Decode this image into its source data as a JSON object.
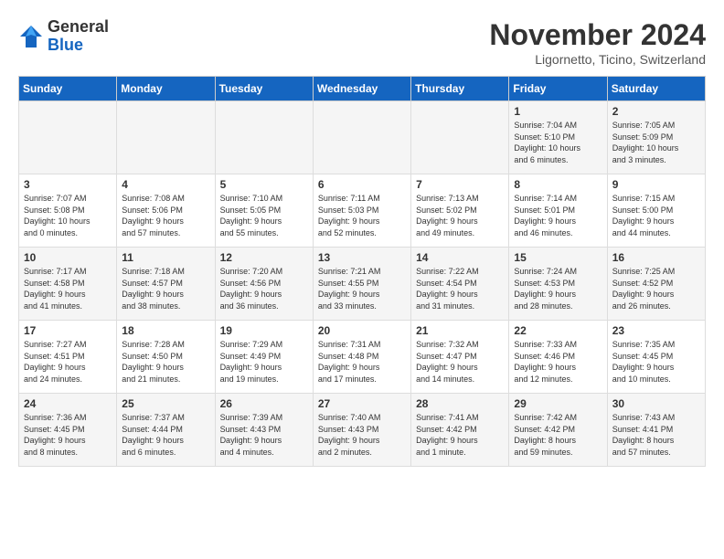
{
  "logo": {
    "general": "General",
    "blue": "Blue"
  },
  "title": "November 2024",
  "location": "Ligornetto, Ticino, Switzerland",
  "days_of_week": [
    "Sunday",
    "Monday",
    "Tuesday",
    "Wednesday",
    "Thursday",
    "Friday",
    "Saturday"
  ],
  "weeks": [
    [
      {
        "day": "",
        "info": ""
      },
      {
        "day": "",
        "info": ""
      },
      {
        "day": "",
        "info": ""
      },
      {
        "day": "",
        "info": ""
      },
      {
        "day": "",
        "info": ""
      },
      {
        "day": "1",
        "info": "Sunrise: 7:04 AM\nSunset: 5:10 PM\nDaylight: 10 hours\nand 6 minutes."
      },
      {
        "day": "2",
        "info": "Sunrise: 7:05 AM\nSunset: 5:09 PM\nDaylight: 10 hours\nand 3 minutes."
      }
    ],
    [
      {
        "day": "3",
        "info": "Sunrise: 7:07 AM\nSunset: 5:08 PM\nDaylight: 10 hours\nand 0 minutes."
      },
      {
        "day": "4",
        "info": "Sunrise: 7:08 AM\nSunset: 5:06 PM\nDaylight: 9 hours\nand 57 minutes."
      },
      {
        "day": "5",
        "info": "Sunrise: 7:10 AM\nSunset: 5:05 PM\nDaylight: 9 hours\nand 55 minutes."
      },
      {
        "day": "6",
        "info": "Sunrise: 7:11 AM\nSunset: 5:03 PM\nDaylight: 9 hours\nand 52 minutes."
      },
      {
        "day": "7",
        "info": "Sunrise: 7:13 AM\nSunset: 5:02 PM\nDaylight: 9 hours\nand 49 minutes."
      },
      {
        "day": "8",
        "info": "Sunrise: 7:14 AM\nSunset: 5:01 PM\nDaylight: 9 hours\nand 46 minutes."
      },
      {
        "day": "9",
        "info": "Sunrise: 7:15 AM\nSunset: 5:00 PM\nDaylight: 9 hours\nand 44 minutes."
      }
    ],
    [
      {
        "day": "10",
        "info": "Sunrise: 7:17 AM\nSunset: 4:58 PM\nDaylight: 9 hours\nand 41 minutes."
      },
      {
        "day": "11",
        "info": "Sunrise: 7:18 AM\nSunset: 4:57 PM\nDaylight: 9 hours\nand 38 minutes."
      },
      {
        "day": "12",
        "info": "Sunrise: 7:20 AM\nSunset: 4:56 PM\nDaylight: 9 hours\nand 36 minutes."
      },
      {
        "day": "13",
        "info": "Sunrise: 7:21 AM\nSunset: 4:55 PM\nDaylight: 9 hours\nand 33 minutes."
      },
      {
        "day": "14",
        "info": "Sunrise: 7:22 AM\nSunset: 4:54 PM\nDaylight: 9 hours\nand 31 minutes."
      },
      {
        "day": "15",
        "info": "Sunrise: 7:24 AM\nSunset: 4:53 PM\nDaylight: 9 hours\nand 28 minutes."
      },
      {
        "day": "16",
        "info": "Sunrise: 7:25 AM\nSunset: 4:52 PM\nDaylight: 9 hours\nand 26 minutes."
      }
    ],
    [
      {
        "day": "17",
        "info": "Sunrise: 7:27 AM\nSunset: 4:51 PM\nDaylight: 9 hours\nand 24 minutes."
      },
      {
        "day": "18",
        "info": "Sunrise: 7:28 AM\nSunset: 4:50 PM\nDaylight: 9 hours\nand 21 minutes."
      },
      {
        "day": "19",
        "info": "Sunrise: 7:29 AM\nSunset: 4:49 PM\nDaylight: 9 hours\nand 19 minutes."
      },
      {
        "day": "20",
        "info": "Sunrise: 7:31 AM\nSunset: 4:48 PM\nDaylight: 9 hours\nand 17 minutes."
      },
      {
        "day": "21",
        "info": "Sunrise: 7:32 AM\nSunset: 4:47 PM\nDaylight: 9 hours\nand 14 minutes."
      },
      {
        "day": "22",
        "info": "Sunrise: 7:33 AM\nSunset: 4:46 PM\nDaylight: 9 hours\nand 12 minutes."
      },
      {
        "day": "23",
        "info": "Sunrise: 7:35 AM\nSunset: 4:45 PM\nDaylight: 9 hours\nand 10 minutes."
      }
    ],
    [
      {
        "day": "24",
        "info": "Sunrise: 7:36 AM\nSunset: 4:45 PM\nDaylight: 9 hours\nand 8 minutes."
      },
      {
        "day": "25",
        "info": "Sunrise: 7:37 AM\nSunset: 4:44 PM\nDaylight: 9 hours\nand 6 minutes."
      },
      {
        "day": "26",
        "info": "Sunrise: 7:39 AM\nSunset: 4:43 PM\nDaylight: 9 hours\nand 4 minutes."
      },
      {
        "day": "27",
        "info": "Sunrise: 7:40 AM\nSunset: 4:43 PM\nDaylight: 9 hours\nand 2 minutes."
      },
      {
        "day": "28",
        "info": "Sunrise: 7:41 AM\nSunset: 4:42 PM\nDaylight: 9 hours\nand 1 minute."
      },
      {
        "day": "29",
        "info": "Sunrise: 7:42 AM\nSunset: 4:42 PM\nDaylight: 8 hours\nand 59 minutes."
      },
      {
        "day": "30",
        "info": "Sunrise: 7:43 AM\nSunset: 4:41 PM\nDaylight: 8 hours\nand 57 minutes."
      }
    ]
  ]
}
